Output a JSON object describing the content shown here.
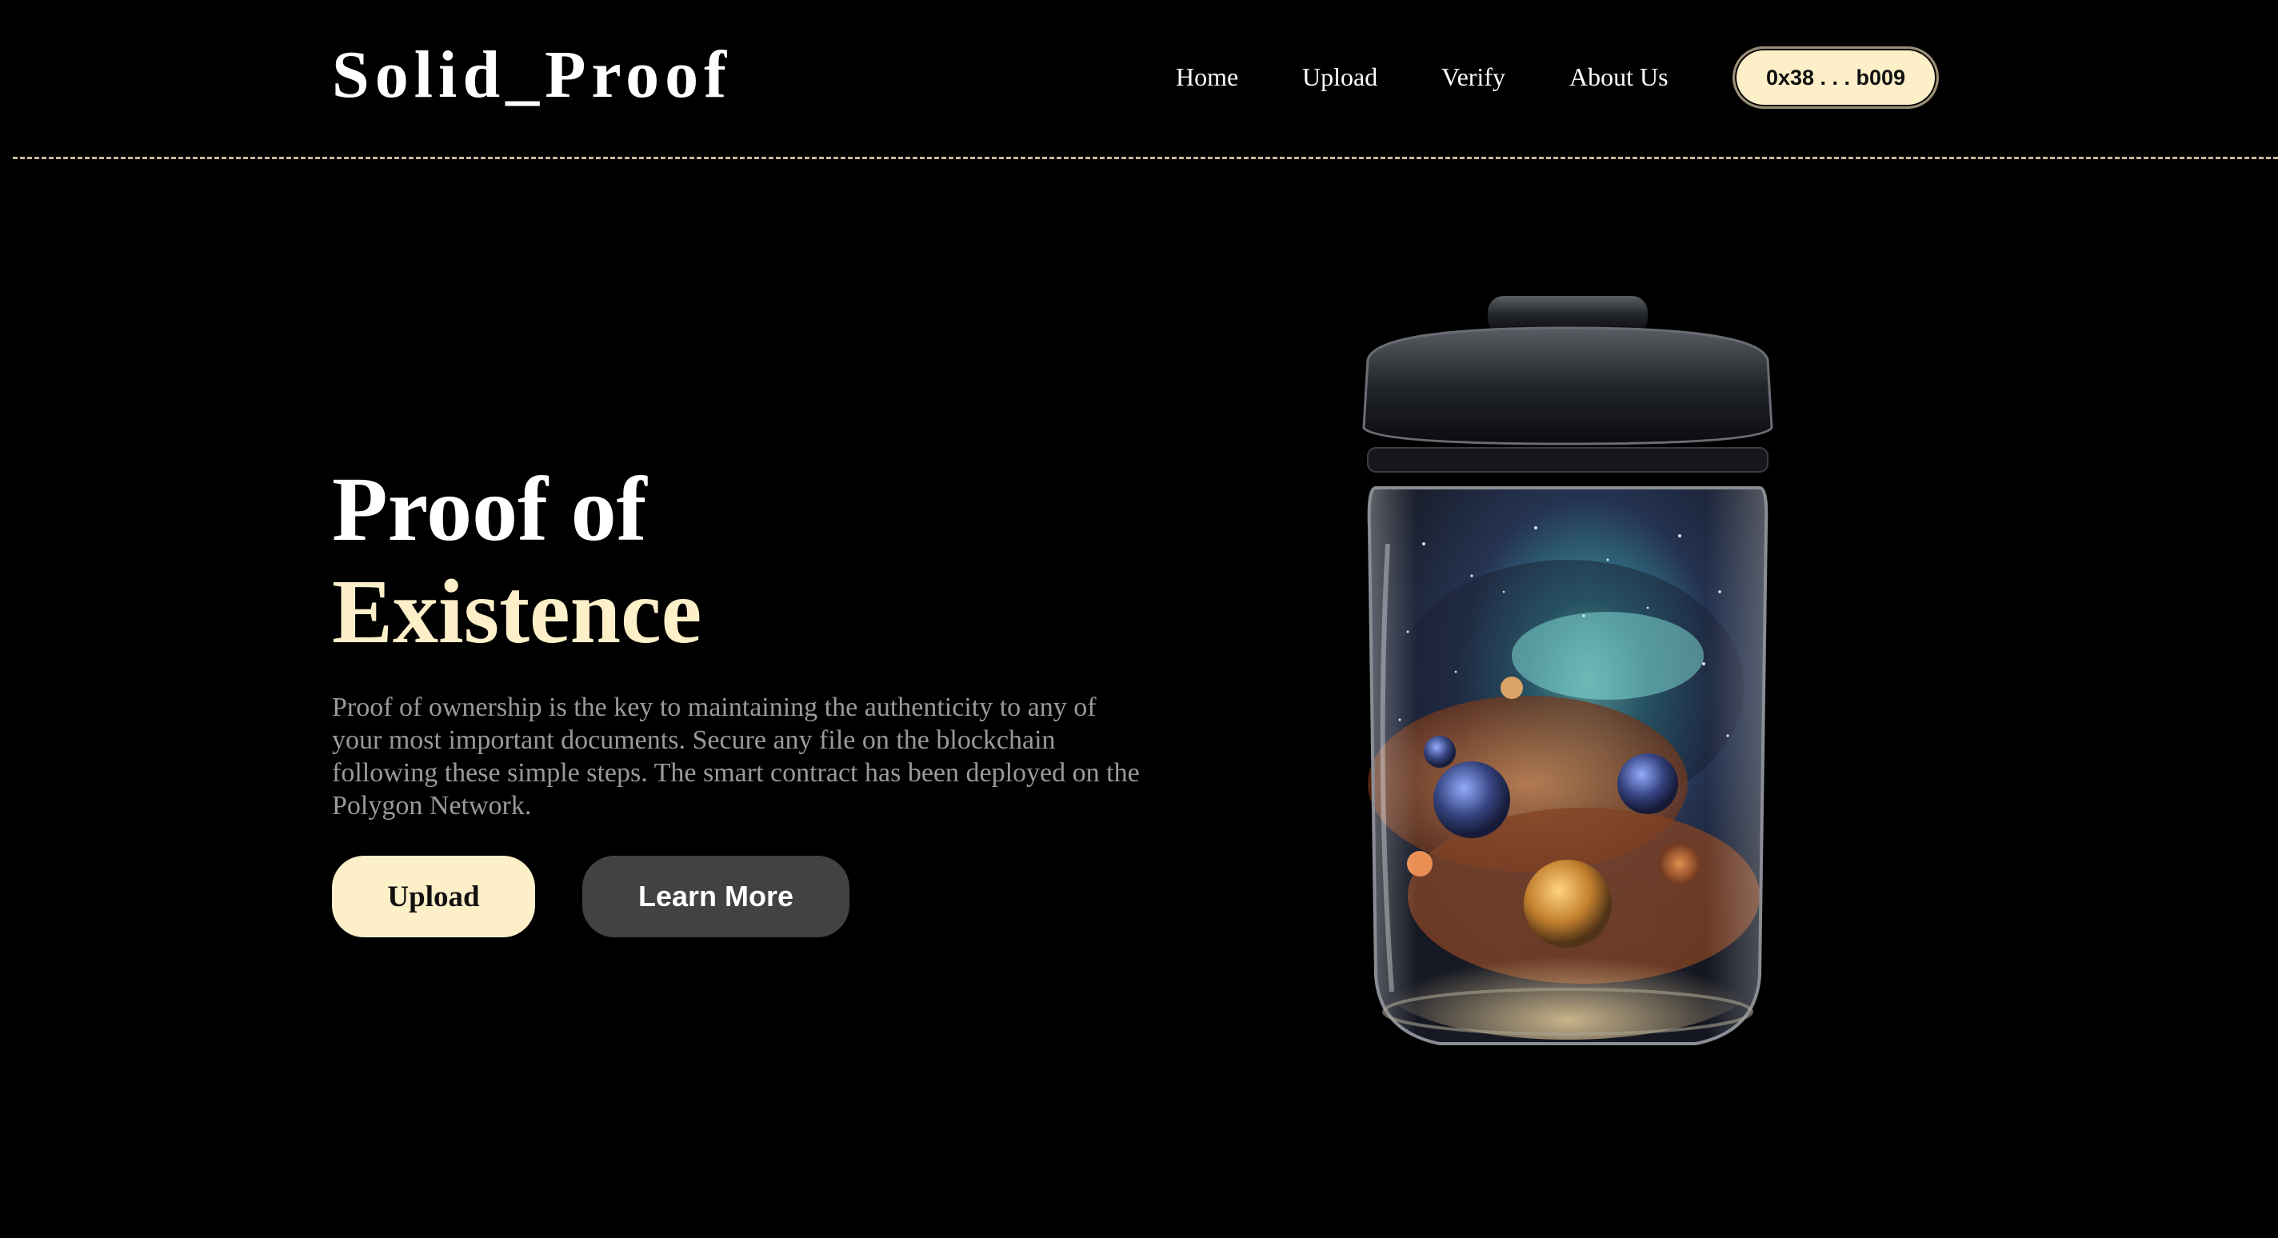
{
  "header": {
    "logo": "Solid_Proof",
    "nav": {
      "home": "Home",
      "upload": "Upload",
      "verify": "Verify",
      "about": "About Us"
    },
    "wallet_address": "0x38 . . . b009"
  },
  "hero": {
    "title_line1": "Proof of",
    "title_line2": "Existence",
    "description": "Proof of ownership is the key to maintaining the authenticity to any of your most important documents. Secure any file on the blockchain following these simple steps. The smart contract has been deployed on the Polygon Network.",
    "upload_button": "Upload",
    "learn_more_button": "Learn More"
  },
  "illustration": {
    "icon": "galaxy-jar-image"
  },
  "colors": {
    "background": "#000000",
    "accent": "#fdefc8",
    "secondary_button": "#424242",
    "body_text": "#9a9a9a",
    "divider": "#c8b995"
  }
}
